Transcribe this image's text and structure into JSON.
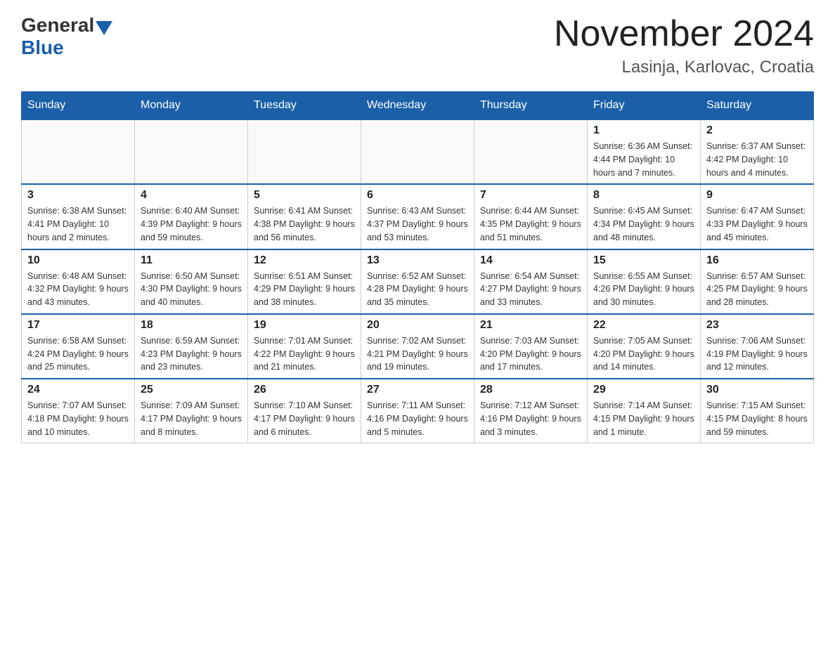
{
  "header": {
    "logo_general": "General",
    "logo_blue": "Blue",
    "month_title": "November 2024",
    "location": "Lasinja, Karlovac, Croatia"
  },
  "days_of_week": [
    "Sunday",
    "Monday",
    "Tuesday",
    "Wednesday",
    "Thursday",
    "Friday",
    "Saturday"
  ],
  "weeks": [
    [
      {
        "day": "",
        "info": ""
      },
      {
        "day": "",
        "info": ""
      },
      {
        "day": "",
        "info": ""
      },
      {
        "day": "",
        "info": ""
      },
      {
        "day": "",
        "info": ""
      },
      {
        "day": "1",
        "info": "Sunrise: 6:36 AM\nSunset: 4:44 PM\nDaylight: 10 hours and 7 minutes."
      },
      {
        "day": "2",
        "info": "Sunrise: 6:37 AM\nSunset: 4:42 PM\nDaylight: 10 hours and 4 minutes."
      }
    ],
    [
      {
        "day": "3",
        "info": "Sunrise: 6:38 AM\nSunset: 4:41 PM\nDaylight: 10 hours and 2 minutes."
      },
      {
        "day": "4",
        "info": "Sunrise: 6:40 AM\nSunset: 4:39 PM\nDaylight: 9 hours and 59 minutes."
      },
      {
        "day": "5",
        "info": "Sunrise: 6:41 AM\nSunset: 4:38 PM\nDaylight: 9 hours and 56 minutes."
      },
      {
        "day": "6",
        "info": "Sunrise: 6:43 AM\nSunset: 4:37 PM\nDaylight: 9 hours and 53 minutes."
      },
      {
        "day": "7",
        "info": "Sunrise: 6:44 AM\nSunset: 4:35 PM\nDaylight: 9 hours and 51 minutes."
      },
      {
        "day": "8",
        "info": "Sunrise: 6:45 AM\nSunset: 4:34 PM\nDaylight: 9 hours and 48 minutes."
      },
      {
        "day": "9",
        "info": "Sunrise: 6:47 AM\nSunset: 4:33 PM\nDaylight: 9 hours and 45 minutes."
      }
    ],
    [
      {
        "day": "10",
        "info": "Sunrise: 6:48 AM\nSunset: 4:32 PM\nDaylight: 9 hours and 43 minutes."
      },
      {
        "day": "11",
        "info": "Sunrise: 6:50 AM\nSunset: 4:30 PM\nDaylight: 9 hours and 40 minutes."
      },
      {
        "day": "12",
        "info": "Sunrise: 6:51 AM\nSunset: 4:29 PM\nDaylight: 9 hours and 38 minutes."
      },
      {
        "day": "13",
        "info": "Sunrise: 6:52 AM\nSunset: 4:28 PM\nDaylight: 9 hours and 35 minutes."
      },
      {
        "day": "14",
        "info": "Sunrise: 6:54 AM\nSunset: 4:27 PM\nDaylight: 9 hours and 33 minutes."
      },
      {
        "day": "15",
        "info": "Sunrise: 6:55 AM\nSunset: 4:26 PM\nDaylight: 9 hours and 30 minutes."
      },
      {
        "day": "16",
        "info": "Sunrise: 6:57 AM\nSunset: 4:25 PM\nDaylight: 9 hours and 28 minutes."
      }
    ],
    [
      {
        "day": "17",
        "info": "Sunrise: 6:58 AM\nSunset: 4:24 PM\nDaylight: 9 hours and 25 minutes."
      },
      {
        "day": "18",
        "info": "Sunrise: 6:59 AM\nSunset: 4:23 PM\nDaylight: 9 hours and 23 minutes."
      },
      {
        "day": "19",
        "info": "Sunrise: 7:01 AM\nSunset: 4:22 PM\nDaylight: 9 hours and 21 minutes."
      },
      {
        "day": "20",
        "info": "Sunrise: 7:02 AM\nSunset: 4:21 PM\nDaylight: 9 hours and 19 minutes."
      },
      {
        "day": "21",
        "info": "Sunrise: 7:03 AM\nSunset: 4:20 PM\nDaylight: 9 hours and 17 minutes."
      },
      {
        "day": "22",
        "info": "Sunrise: 7:05 AM\nSunset: 4:20 PM\nDaylight: 9 hours and 14 minutes."
      },
      {
        "day": "23",
        "info": "Sunrise: 7:06 AM\nSunset: 4:19 PM\nDaylight: 9 hours and 12 minutes."
      }
    ],
    [
      {
        "day": "24",
        "info": "Sunrise: 7:07 AM\nSunset: 4:18 PM\nDaylight: 9 hours and 10 minutes."
      },
      {
        "day": "25",
        "info": "Sunrise: 7:09 AM\nSunset: 4:17 PM\nDaylight: 9 hours and 8 minutes."
      },
      {
        "day": "26",
        "info": "Sunrise: 7:10 AM\nSunset: 4:17 PM\nDaylight: 9 hours and 6 minutes."
      },
      {
        "day": "27",
        "info": "Sunrise: 7:11 AM\nSunset: 4:16 PM\nDaylight: 9 hours and 5 minutes."
      },
      {
        "day": "28",
        "info": "Sunrise: 7:12 AM\nSunset: 4:16 PM\nDaylight: 9 hours and 3 minutes."
      },
      {
        "day": "29",
        "info": "Sunrise: 7:14 AM\nSunset: 4:15 PM\nDaylight: 9 hours and 1 minute."
      },
      {
        "day": "30",
        "info": "Sunrise: 7:15 AM\nSunset: 4:15 PM\nDaylight: 8 hours and 59 minutes."
      }
    ]
  ]
}
